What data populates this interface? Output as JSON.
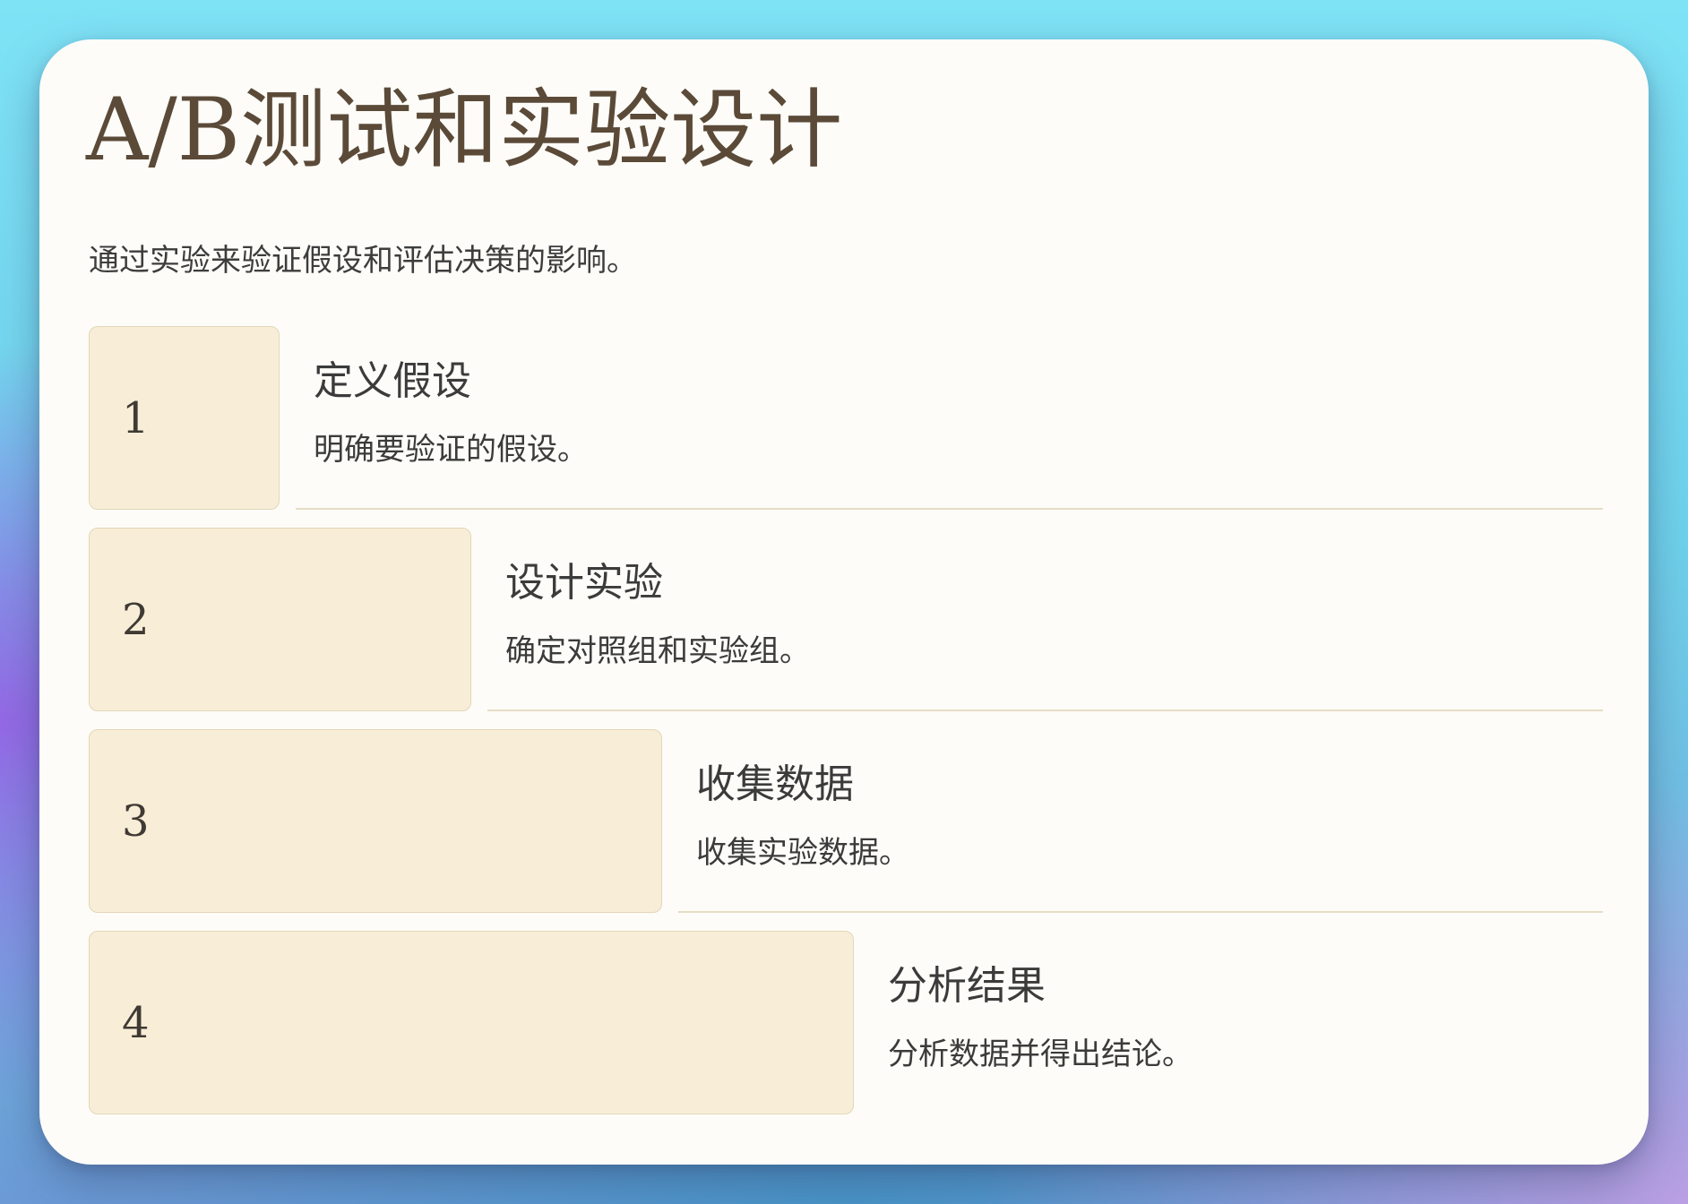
{
  "page": {
    "title": "A/B测试和实验设计",
    "subtitle": "通过实验来验证假设和评估决策的影响。"
  },
  "steps": [
    {
      "number": "1",
      "title": "定义假设",
      "description": "明确要验证的假设。"
    },
    {
      "number": "2",
      "title": "设计实验",
      "description": "确定对照组和实验组。"
    },
    {
      "number": "3",
      "title": "收集数据",
      "description": "收集实验数据。"
    },
    {
      "number": "4",
      "title": "分析结果",
      "description": "分析数据并得出结论。"
    }
  ],
  "colors": {
    "card_background": "#fdfcf8",
    "title_color": "#5b4a38",
    "step_box_fill": "#f8eed8",
    "step_box_border": "#e3d6b8",
    "divider": "#e6ddc6"
  }
}
